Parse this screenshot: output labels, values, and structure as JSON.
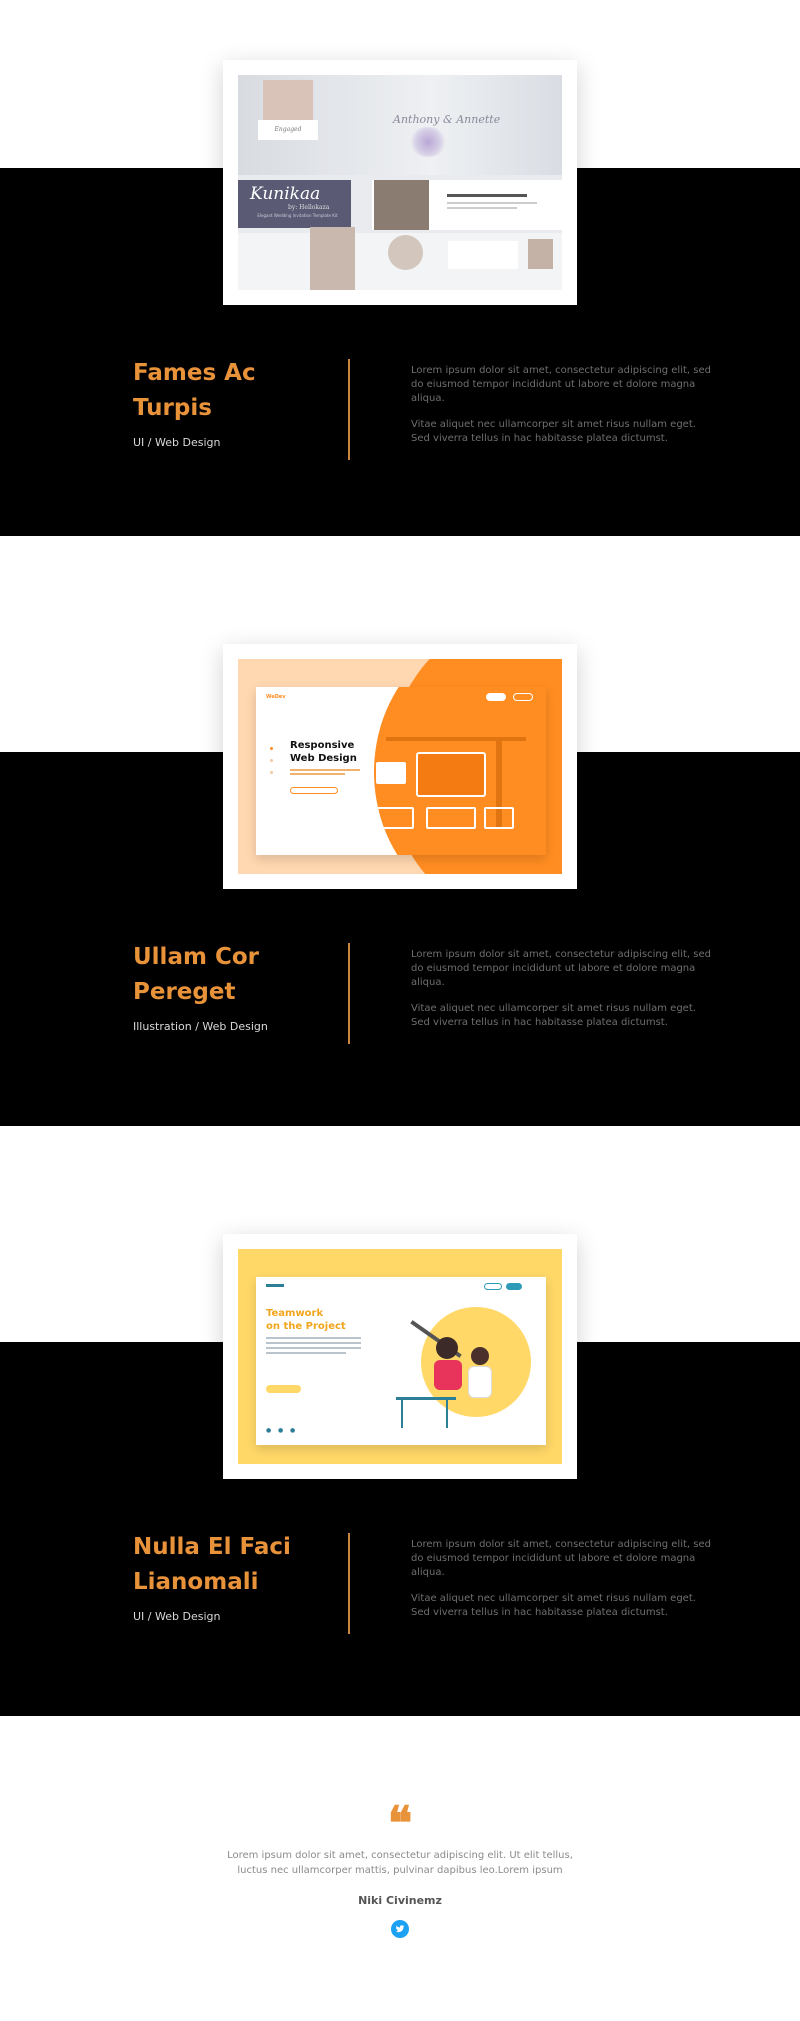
{
  "projects": [
    {
      "title_line1": "Fames Ac",
      "title_line2": "Turpis",
      "category": "UI / Web Design",
      "desc1": "Lorem ipsum dolor sit amet, consectetur adipiscing elit, sed do eiusmod tempor incididunt ut labore et dolore magna aliqua.",
      "desc2": "Vitae aliquet nec ullamcorper sit amet risus nullam eget. Sed viverra tellus in hac habitasse platea dictumst.",
      "shot": {
        "script_title": "Kunikaa",
        "script_sub": "by: Hellokaza",
        "script_caption": "Elegant Wedding Invitation Template Kit",
        "names": "Anthony & Annette",
        "badge": "Engaged"
      }
    },
    {
      "title_line1": "Ullam Cor",
      "title_line2": "Pereget",
      "category": "Illustration / Web Design",
      "desc1": "Lorem ipsum dolor sit amet, consectetur adipiscing elit, sed do eiusmod tempor incididunt ut labore et dolore magna aliqua.",
      "desc2": "Vitae aliquet nec ullamcorper sit amet risus nullam eget. Sed viverra tellus in hac habitasse platea dictumst.",
      "shot": {
        "brand": "WeDev",
        "headline1": "Responsive",
        "headline2": "Web Design"
      }
    },
    {
      "title_line1": "Nulla El Faci",
      "title_line2": "Lianomali",
      "category": "UI / Web Design",
      "desc1": "Lorem ipsum dolor sit amet, consectetur adipiscing elit, sed do eiusmod tempor incididunt ut labore et dolore magna aliqua.",
      "desc2": "Vitae aliquet nec ullamcorper sit amet risus nullam eget. Sed viverra tellus in hac habitasse platea dictumst.",
      "shot": {
        "headline1": "Teamwork",
        "headline2": "on the Project"
      }
    }
  ],
  "testimonial": {
    "mark": "❝",
    "text": "Lorem ipsum dolor sit amet, consectetur adipiscing elit. Ut elit tellus, luctus nec ullamcorper mattis, pulvinar dapibus leo.Lorem ipsum",
    "author": "Niki Civinemz",
    "icon": "twitter-icon"
  },
  "colors": {
    "accent": "#e8923a",
    "band": "#000000",
    "twitter": "#1da1f2"
  }
}
